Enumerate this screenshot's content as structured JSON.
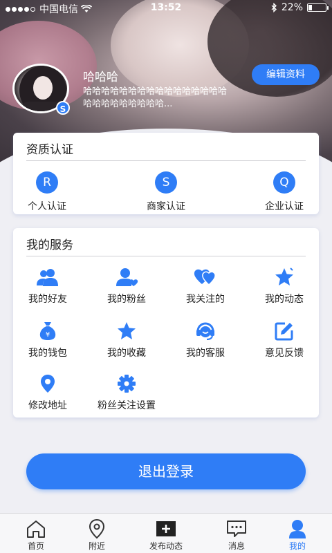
{
  "status_bar": {
    "carrier": "中国电信",
    "time": "13:52",
    "battery": "22%"
  },
  "profile": {
    "username": "哈哈哈",
    "bio": "哈哈哈哈哈哈哈哈哈哈哈哈哈哈哈哈哈哈哈哈哈哈哈哈哈...",
    "avatar_badge": "S",
    "edit_button": "编辑资料"
  },
  "certification": {
    "title": "资质认证",
    "items": [
      {
        "letter": "R",
        "label": "个人认证"
      },
      {
        "letter": "S",
        "label": "商家认证"
      },
      {
        "letter": "Q",
        "label": "企业认证"
      }
    ]
  },
  "services": {
    "title": "我的服务",
    "items": [
      {
        "icon": "friends-icon",
        "label": "我的好友"
      },
      {
        "icon": "fans-icon",
        "label": "我的粉丝"
      },
      {
        "icon": "following-icon",
        "label": "我关注的"
      },
      {
        "icon": "moments-icon",
        "label": "我的动态"
      },
      {
        "icon": "wallet-icon",
        "label": "我的钱包"
      },
      {
        "icon": "favorites-icon",
        "label": "我的收藏"
      },
      {
        "icon": "customer-service-icon",
        "label": "我的客服"
      },
      {
        "icon": "feedback-icon",
        "label": "意见反馈"
      },
      {
        "icon": "location-icon",
        "label": "修改地址"
      },
      {
        "icon": "settings-icon",
        "label": "粉丝关注设置"
      }
    ]
  },
  "logout_button": "退出登录",
  "tabbar": {
    "items": [
      {
        "icon": "home-icon",
        "label": "首页"
      },
      {
        "icon": "nearby-icon",
        "label": "附近"
      },
      {
        "icon": "publish-icon",
        "label": "发布动态"
      },
      {
        "icon": "messages-icon",
        "label": "消息"
      },
      {
        "icon": "profile-icon",
        "label": "我的"
      }
    ],
    "active": "我的"
  },
  "colors": {
    "accent": "#2f7df6",
    "background": "#efeff4"
  }
}
